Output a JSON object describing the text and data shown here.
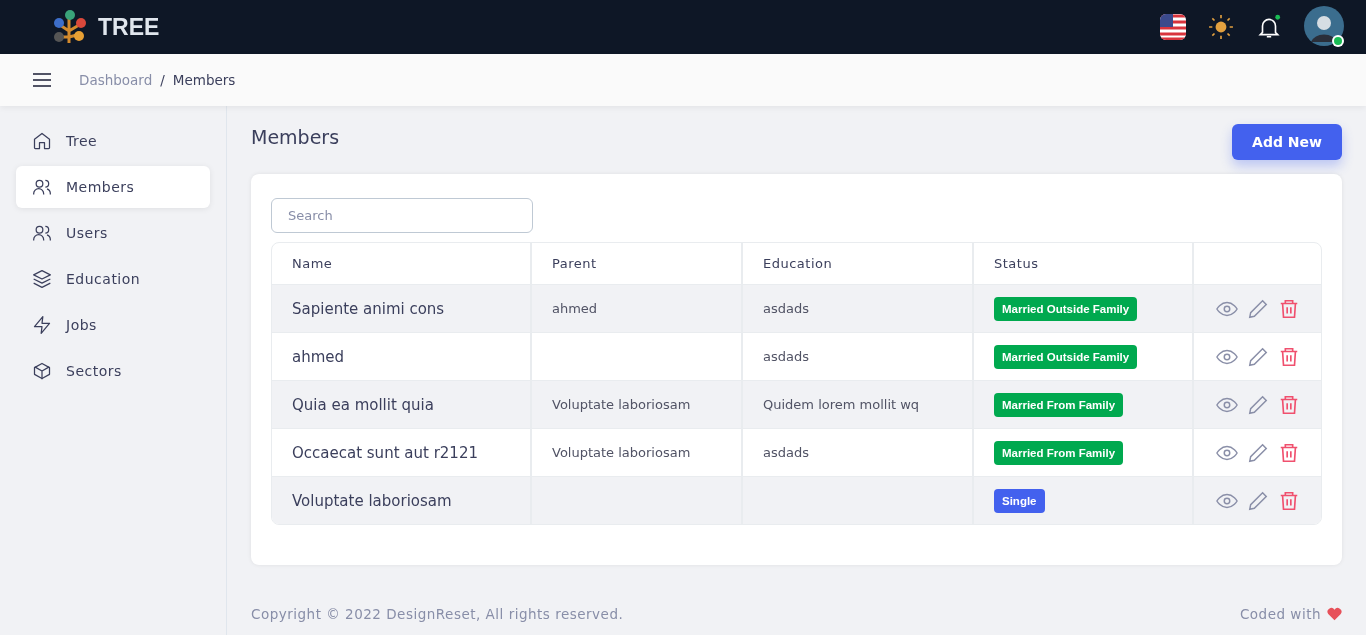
{
  "brand": {
    "title": "TREE"
  },
  "breadcrumb": [
    {
      "label": "Dashboard",
      "selected": false
    },
    {
      "label": "Members",
      "selected": true
    }
  ],
  "breadcrumb_separator": "/",
  "sidebar": {
    "items": [
      {
        "label": "Tree",
        "selected": false
      },
      {
        "label": "Members",
        "selected": true
      },
      {
        "label": "Users",
        "selected": false
      },
      {
        "label": "Education",
        "selected": false
      },
      {
        "label": "Jobs",
        "selected": false
      },
      {
        "label": "Sectors",
        "selected": false
      }
    ]
  },
  "page": {
    "title": "Members",
    "add_button": "Add New"
  },
  "search": {
    "placeholder": "Search"
  },
  "table": {
    "columns": [
      "Name",
      "Parent",
      "Education",
      "Status"
    ],
    "rows": [
      {
        "name": "Sapiente animi cons",
        "parent": "ahmed",
        "education": "asdads",
        "status": {
          "label": "Married Outside Family",
          "color": "#00a94f"
        }
      },
      {
        "name": "ahmed",
        "parent": "",
        "education": "asdads",
        "status": {
          "label": "Married Outside Family",
          "color": "#00a94f"
        }
      },
      {
        "name": "Quia ea mollit quia",
        "parent": "Voluptate laboriosam",
        "education": "Quidem lorem mollit wq",
        "status": {
          "label": "Married From Family",
          "color": "#00a94f"
        }
      },
      {
        "name": "Occaecat sunt aut r2121",
        "parent": "Voluptate laboriosam",
        "education": "asdads",
        "status": {
          "label": "Married From Family",
          "color": "#00a94f"
        }
      },
      {
        "name": "Voluptate laboriosam",
        "parent": "",
        "education": "",
        "status": {
          "label": "Single",
          "color": "#4361ee"
        }
      }
    ]
  },
  "footer": {
    "copyright": "Copyright © 2022 DesignReset, All rights reserved.",
    "coded_with": "Coded with"
  }
}
